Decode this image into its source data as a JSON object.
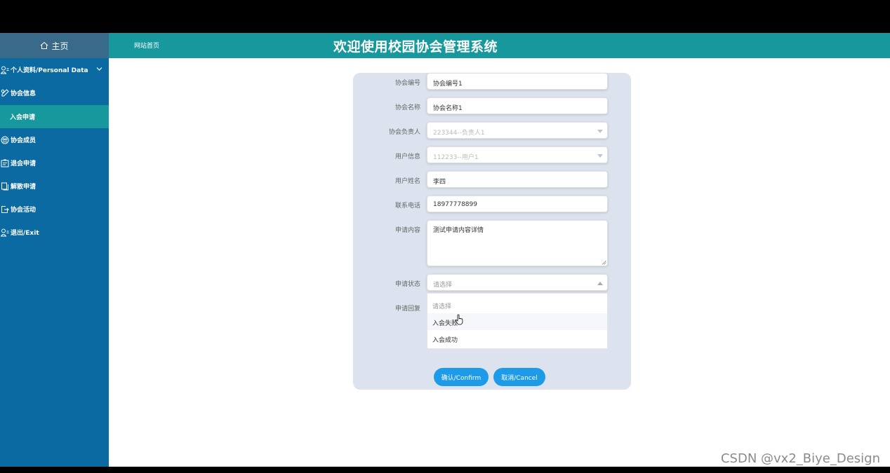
{
  "header": {
    "home_tab": "主页",
    "site_home": "网站首页",
    "system_title": "欢迎使用校园协会管理系统"
  },
  "sidebar": {
    "items": [
      {
        "label": "个人资料/Personal Data",
        "icon": "user-icon"
      },
      {
        "label": "协会信息",
        "icon": "edit-icon"
      },
      {
        "label": "入会申请",
        "icon": "",
        "active": true
      },
      {
        "label": "协会成员",
        "icon": "group-icon"
      },
      {
        "label": "退会申请",
        "icon": "form-icon"
      },
      {
        "label": "解散申请",
        "icon": "document-icon"
      },
      {
        "label": "协会活动",
        "icon": "export-icon"
      },
      {
        "label": "退出/Exit",
        "icon": "logout-icon"
      }
    ]
  },
  "form": {
    "fields": [
      {
        "label": "协会编号",
        "value": "协会编号1"
      },
      {
        "label": "协会名称",
        "value": "协会名称1"
      },
      {
        "label": "协会负责人",
        "value": "223344--负责人1",
        "disabled": true
      },
      {
        "label": "用户信息",
        "value": "112233--用户1",
        "disabled": true
      },
      {
        "label": "用户姓名",
        "value": "李四"
      },
      {
        "label": "联系电话",
        "value": "18977778899"
      },
      {
        "label": "申请内容",
        "value": "测试申请内容详情"
      },
      {
        "label": "申请状态",
        "placeholder": "请选择"
      },
      {
        "label": "申请回复"
      }
    ],
    "status_options": [
      "请选择",
      "入会失败",
      "入会成功"
    ],
    "confirm_label": "确认/Confirm",
    "cancel_label": "取消/Cancel"
  },
  "colors": {
    "header": "#17989c",
    "sidebar": "#0a6aa1",
    "active_item": "#17989c",
    "panel": "#dce3ee",
    "button": "#1e9be8"
  },
  "watermark": "CSDN @vx2_Biye_Design"
}
